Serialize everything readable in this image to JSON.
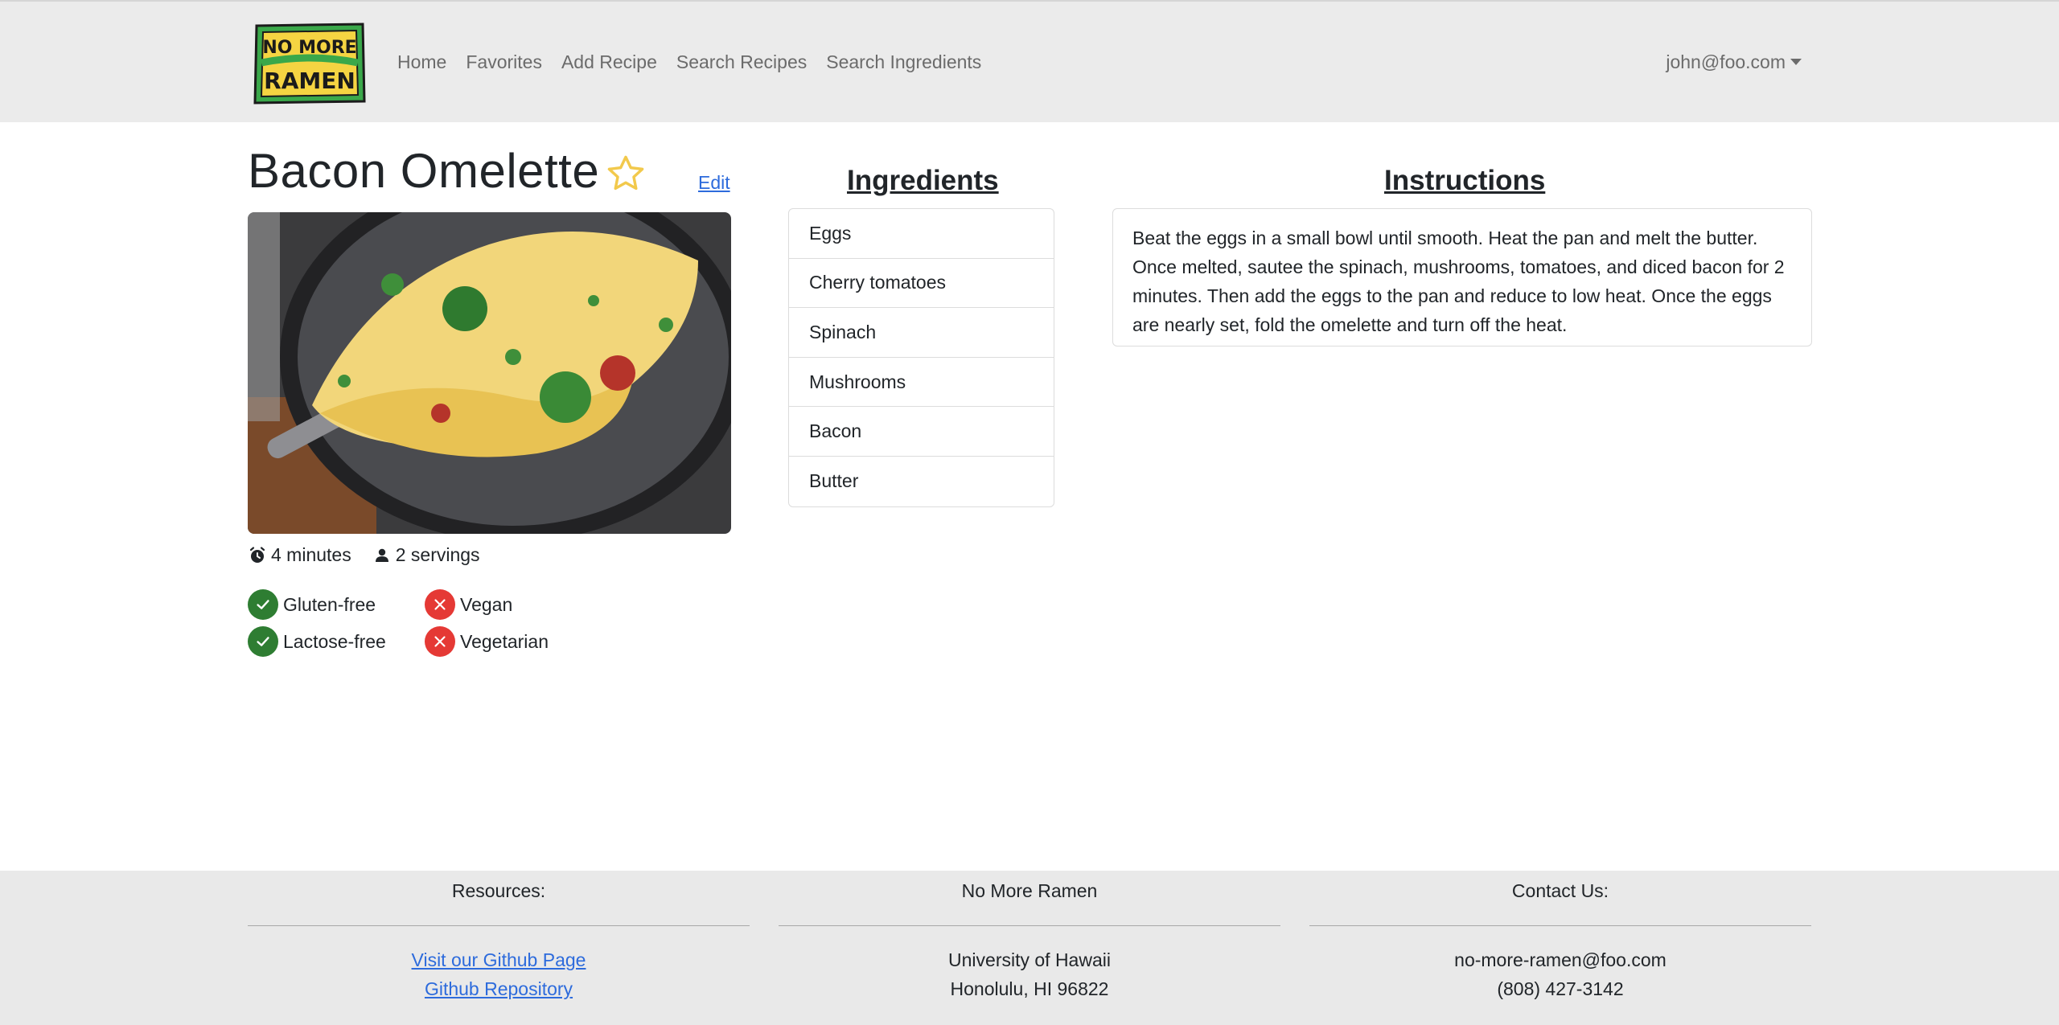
{
  "brand": {
    "logo_text_line1": "NO MORE",
    "logo_text_line2": "RAMEN"
  },
  "nav": {
    "links": [
      "Home",
      "Favorites",
      "Add Recipe",
      "Search Recipes",
      "Search Ingredients"
    ],
    "user": "john@foo.com"
  },
  "recipe": {
    "title": "Bacon Omelette",
    "edit_label": "Edit",
    "time": "4 minutes",
    "servings": "2 servings",
    "diet": [
      {
        "label": "Gluten-free",
        "ok": true
      },
      {
        "label": "Vegan",
        "ok": false
      },
      {
        "label": "Lactose-free",
        "ok": true
      },
      {
        "label": "Vegetarian",
        "ok": false
      }
    ]
  },
  "ingredients": {
    "heading": "Ingredients",
    "items": [
      "Eggs",
      "Cherry tomatoes",
      "Spinach",
      "Mushrooms",
      "Bacon",
      "Butter"
    ]
  },
  "instructions": {
    "heading": "Instructions",
    "text": "Beat the eggs in a small bowl until smooth. Heat the pan and melt the butter. Once melted, sautee the spinach, mushrooms, tomatoes, and diced bacon for 2 minutes. Then add the eggs to the pan and reduce to low heat. Once the eggs are nearly set, fold the omelette and turn off the heat."
  },
  "footer": {
    "resources": {
      "heading": "Resources:",
      "links": [
        "Visit our Github Page",
        "Github Repository"
      ]
    },
    "org": {
      "heading": "No More Ramen",
      "lines": [
        "University of Hawaii",
        "Honolulu, HI 96822"
      ]
    },
    "contact": {
      "heading": "Contact Us:",
      "lines": [
        "no-more-ramen@foo.com",
        "(808) 427-3142"
      ]
    }
  },
  "colors": {
    "navbar_bg": "#ebebeb",
    "link": "#2d6bdc",
    "check_green": "#2e7d32",
    "cross_red": "#e53935",
    "star": "#f2c94c",
    "logo_green": "#3aa84a",
    "logo_yellow": "#f5d442"
  }
}
